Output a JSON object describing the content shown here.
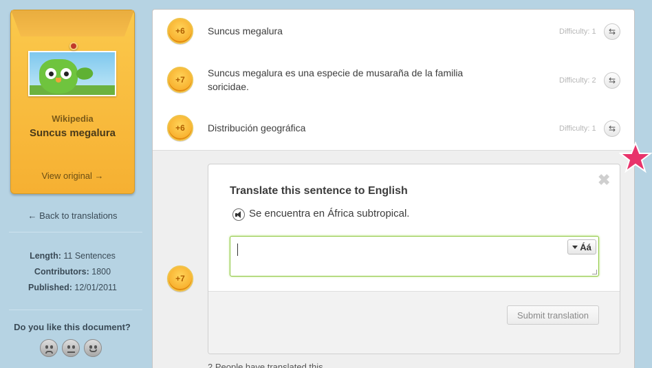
{
  "source": {
    "label": "Wikipedia",
    "title": "Suncus megalura",
    "view_original": "View original →"
  },
  "back_link": "← Back to translations",
  "meta": {
    "length_label": "Length:",
    "length_value": "11 Sentences",
    "contributors_label": "Contributors:",
    "contributors_value": "1800",
    "published_label": "Published:",
    "published_value": "12/01/2011"
  },
  "feedback": {
    "question": "Do you like this document?",
    "icons": [
      "sad-face-icon",
      "neutral-face-icon",
      "happy-face-icon"
    ]
  },
  "sentences": [
    {
      "points": "+6",
      "text": "Suncus megalura",
      "difficulty": "Difficulty: 1"
    },
    {
      "points": "+7",
      "text": "Suncus megalura es una especie de musaraña de la familia",
      "text2": "soricidae.",
      "difficulty": "Difficulty: 2"
    },
    {
      "points": "+6",
      "text": "Distribución geográfica",
      "difficulty": "Difficulty: 1"
    }
  ],
  "translate": {
    "points": "+7",
    "close": "✖",
    "title": "Translate this sentence to English",
    "sentence": "Se encuentra en África subtropical.",
    "input_value": "",
    "accent_label": "Áá",
    "submit_label": "Submit translation"
  },
  "bottom_text": "2 People have translated this",
  "colors": {
    "background": "#b6d3e3",
    "folder": "#f6b032",
    "coin": "#f5a21d",
    "input_focus": "#8cc63f",
    "star": "#e8336b"
  }
}
